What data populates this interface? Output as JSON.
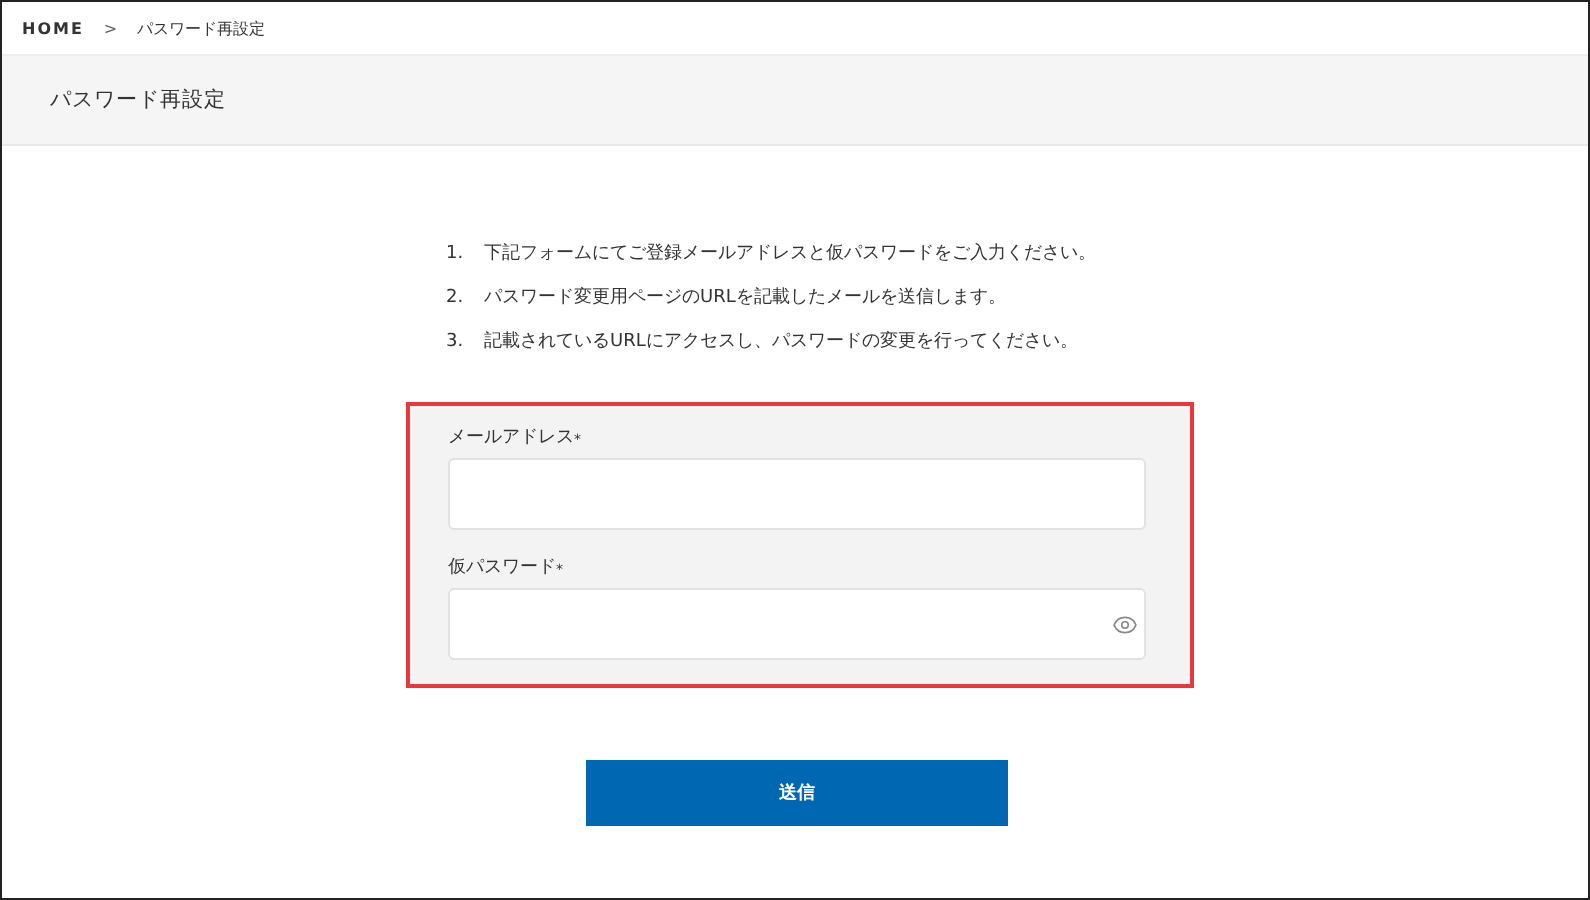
{
  "breadcrumb": {
    "items": [
      "HOME",
      "パスワード再設定"
    ],
    "separator": ">"
  },
  "header": {
    "title": "パスワード再設定"
  },
  "steps": [
    {
      "number": "1.",
      "text": "下記フォームにてご登録メールアドレスと仮パスワードをご入力ください。"
    },
    {
      "number": "2.",
      "text": "パスワード変更用ページのURLを記載したメールを送信します。"
    },
    {
      "number": "3.",
      "text": "記載されているURLにアクセスし、パスワードの変更を行ってください。"
    }
  ],
  "form": {
    "fields": [
      {
        "kind": "email",
        "label": "メールアドレス",
        "required_mark": "*"
      },
      {
        "kind": "password",
        "label": "仮パスワード",
        "required_mark": "*"
      }
    ]
  },
  "submit": {
    "label": "送信"
  }
}
